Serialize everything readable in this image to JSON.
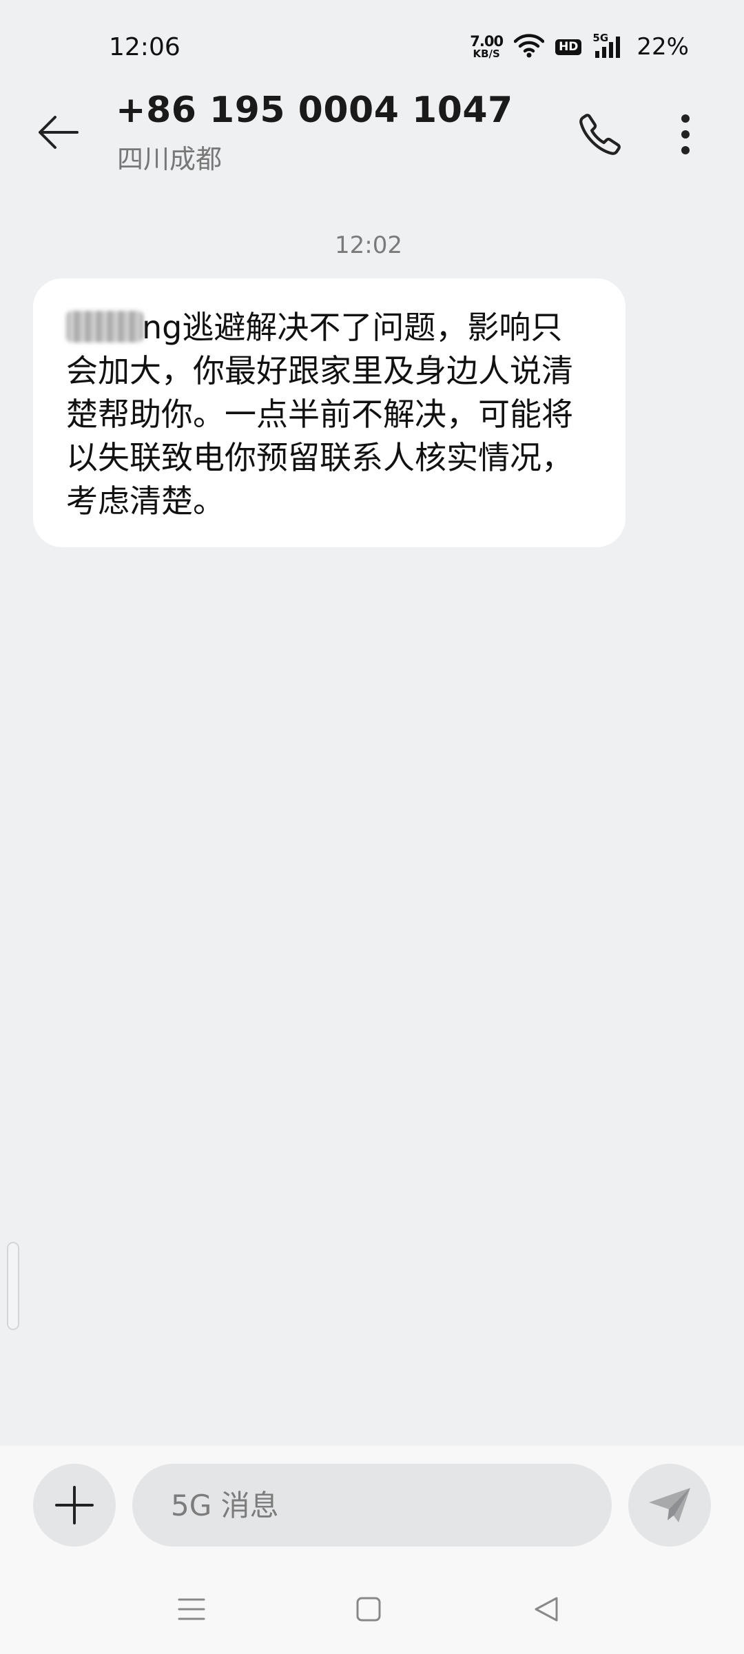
{
  "status_bar": {
    "time": "12:06",
    "net_speed_value": "7.00",
    "net_speed_unit": "KB/S",
    "hd_label": "HD",
    "network_type": "5G",
    "battery": "22%"
  },
  "header": {
    "title": "+86 195 0004 1047",
    "subtitle": "四川成都"
  },
  "conversation": {
    "timestamp": "12:02",
    "messages": [
      {
        "visible_text": "ng逃避解决不了问题，影响只会加大，你最好跟家里及身边人说清楚帮助你。一点半前不解决，可能将以失联致电你预留联系人核实情况，考虑清楚。"
      }
    ]
  },
  "input": {
    "placeholder": "5G 消息"
  },
  "icons": {
    "back": "back-arrow-icon",
    "call": "phone-icon",
    "more": "more-vertical-icon",
    "add": "plus-icon",
    "send": "send-icon",
    "wifi": "wifi-icon",
    "signal": "signal-icon",
    "nav_menu": "menu-icon",
    "nav_home": "home-icon",
    "nav_back": "nav-back-icon"
  },
  "colors": {
    "background": "#eff0f2",
    "bubble": "#ffffff",
    "input_bg": "#e4e5e7"
  }
}
